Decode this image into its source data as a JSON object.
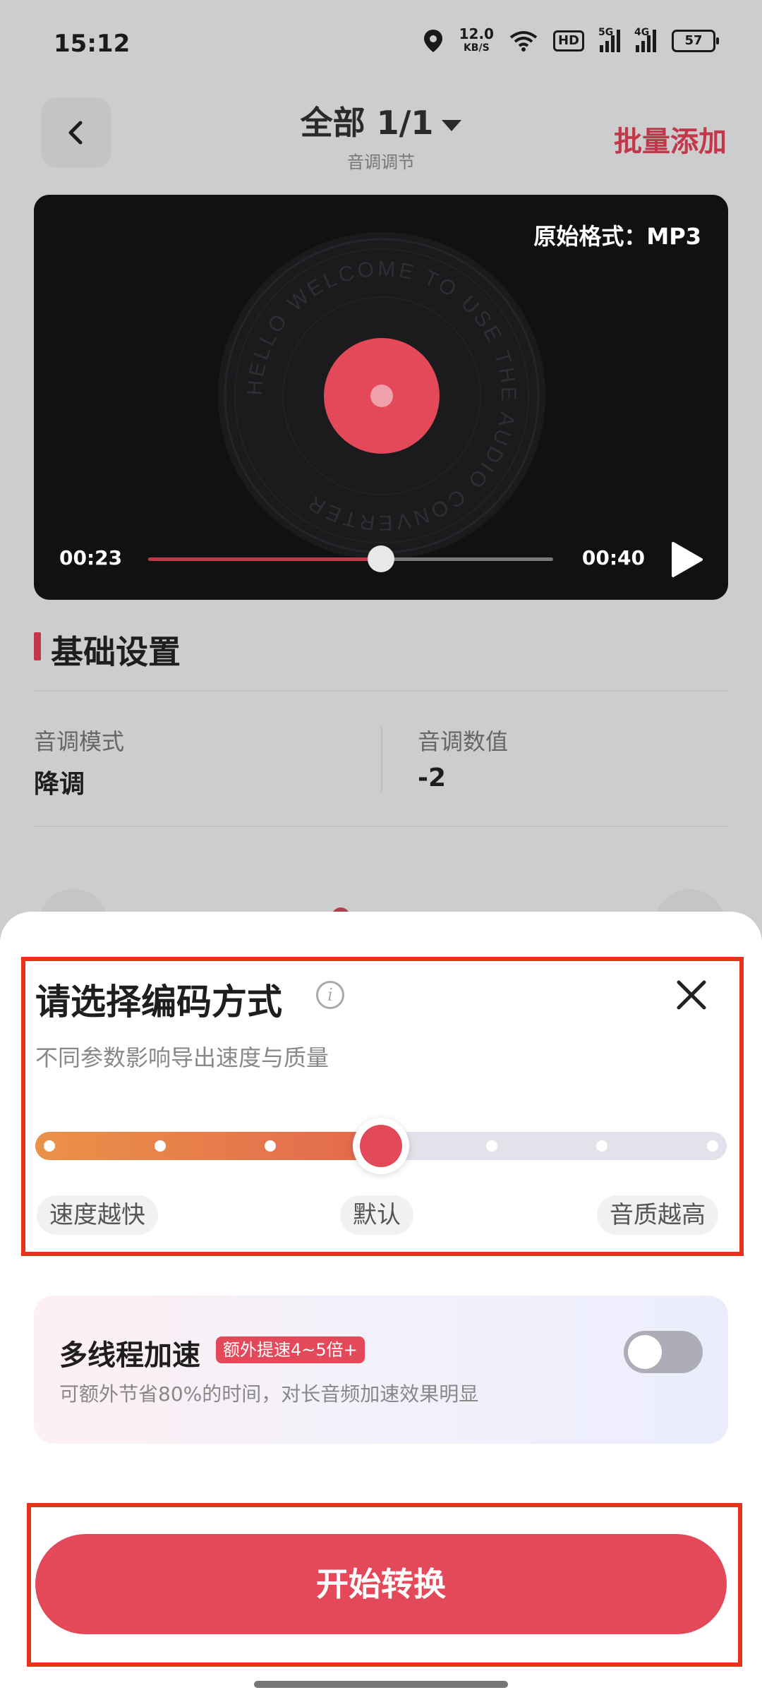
{
  "status_bar": {
    "time": "15:12",
    "net_speed_value": "12.0",
    "net_speed_unit": "KB/S",
    "hd_label": "HD",
    "sim1_label": "5G",
    "sim2_label": "4G",
    "battery": "57"
  },
  "header": {
    "title": "全部 1/1",
    "subtitle": "音调调节",
    "batch_add": "批量添加"
  },
  "player": {
    "original_format": "原始格式：MP3",
    "vinyl_text": "HELLO WELCOME TO USE THE AUDIO CONVERTER",
    "current_time": "00:23",
    "total_time": "00:40",
    "progress": 0.575
  },
  "basic_settings": {
    "title": "基础设置",
    "pitch_mode_label": "音调模式",
    "pitch_mode_value": "降调",
    "pitch_value_label": "音调数值",
    "pitch_value": "-2"
  },
  "encode_sheet": {
    "title": "请选择编码方式",
    "subtitle": "不同参数影响导出速度与质量",
    "steps": 7,
    "selected_step": 3,
    "label_fast": "速度越快",
    "label_default": "默认",
    "label_quality": "音质越高"
  },
  "multithread": {
    "title": "多线程加速",
    "badge": "额外提速4~5倍+",
    "desc": "可额外节省80%的时间，对长音频加速效果明显",
    "enabled": false
  },
  "start_button": "开始转换",
  "colors": {
    "accent": "#e4495a",
    "slider_start": "#ea9248",
    "highlight_box": "#e8321c"
  }
}
